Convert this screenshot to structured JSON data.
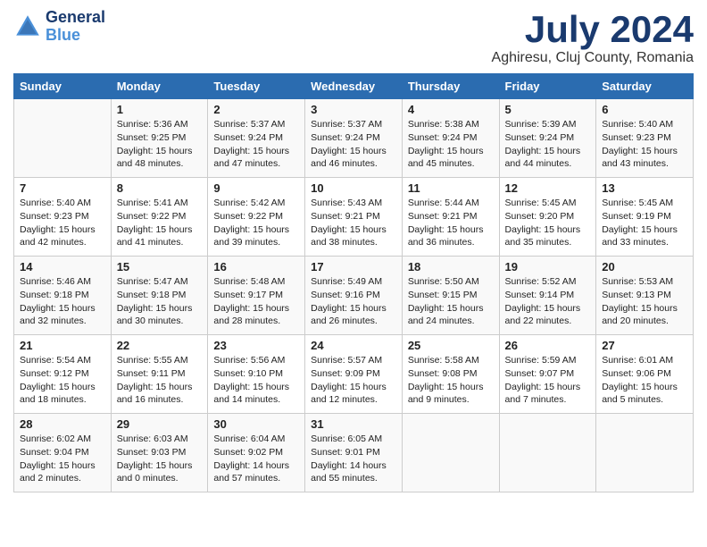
{
  "logo": {
    "line1": "General",
    "line2": "Blue"
  },
  "title": "July 2024",
  "subtitle": "Aghiresu, Cluj County, Romania",
  "columns": [
    "Sunday",
    "Monday",
    "Tuesday",
    "Wednesday",
    "Thursday",
    "Friday",
    "Saturday"
  ],
  "weeks": [
    [
      {
        "day": "",
        "info": ""
      },
      {
        "day": "1",
        "info": "Sunrise: 5:36 AM\nSunset: 9:25 PM\nDaylight: 15 hours\nand 48 minutes."
      },
      {
        "day": "2",
        "info": "Sunrise: 5:37 AM\nSunset: 9:24 PM\nDaylight: 15 hours\nand 47 minutes."
      },
      {
        "day": "3",
        "info": "Sunrise: 5:37 AM\nSunset: 9:24 PM\nDaylight: 15 hours\nand 46 minutes."
      },
      {
        "day": "4",
        "info": "Sunrise: 5:38 AM\nSunset: 9:24 PM\nDaylight: 15 hours\nand 45 minutes."
      },
      {
        "day": "5",
        "info": "Sunrise: 5:39 AM\nSunset: 9:24 PM\nDaylight: 15 hours\nand 44 minutes."
      },
      {
        "day": "6",
        "info": "Sunrise: 5:40 AM\nSunset: 9:23 PM\nDaylight: 15 hours\nand 43 minutes."
      }
    ],
    [
      {
        "day": "7",
        "info": "Sunrise: 5:40 AM\nSunset: 9:23 PM\nDaylight: 15 hours\nand 42 minutes."
      },
      {
        "day": "8",
        "info": "Sunrise: 5:41 AM\nSunset: 9:22 PM\nDaylight: 15 hours\nand 41 minutes."
      },
      {
        "day": "9",
        "info": "Sunrise: 5:42 AM\nSunset: 9:22 PM\nDaylight: 15 hours\nand 39 minutes."
      },
      {
        "day": "10",
        "info": "Sunrise: 5:43 AM\nSunset: 9:21 PM\nDaylight: 15 hours\nand 38 minutes."
      },
      {
        "day": "11",
        "info": "Sunrise: 5:44 AM\nSunset: 9:21 PM\nDaylight: 15 hours\nand 36 minutes."
      },
      {
        "day": "12",
        "info": "Sunrise: 5:45 AM\nSunset: 9:20 PM\nDaylight: 15 hours\nand 35 minutes."
      },
      {
        "day": "13",
        "info": "Sunrise: 5:45 AM\nSunset: 9:19 PM\nDaylight: 15 hours\nand 33 minutes."
      }
    ],
    [
      {
        "day": "14",
        "info": "Sunrise: 5:46 AM\nSunset: 9:18 PM\nDaylight: 15 hours\nand 32 minutes."
      },
      {
        "day": "15",
        "info": "Sunrise: 5:47 AM\nSunset: 9:18 PM\nDaylight: 15 hours\nand 30 minutes."
      },
      {
        "day": "16",
        "info": "Sunrise: 5:48 AM\nSunset: 9:17 PM\nDaylight: 15 hours\nand 28 minutes."
      },
      {
        "day": "17",
        "info": "Sunrise: 5:49 AM\nSunset: 9:16 PM\nDaylight: 15 hours\nand 26 minutes."
      },
      {
        "day": "18",
        "info": "Sunrise: 5:50 AM\nSunset: 9:15 PM\nDaylight: 15 hours\nand 24 minutes."
      },
      {
        "day": "19",
        "info": "Sunrise: 5:52 AM\nSunset: 9:14 PM\nDaylight: 15 hours\nand 22 minutes."
      },
      {
        "day": "20",
        "info": "Sunrise: 5:53 AM\nSunset: 9:13 PM\nDaylight: 15 hours\nand 20 minutes."
      }
    ],
    [
      {
        "day": "21",
        "info": "Sunrise: 5:54 AM\nSunset: 9:12 PM\nDaylight: 15 hours\nand 18 minutes."
      },
      {
        "day": "22",
        "info": "Sunrise: 5:55 AM\nSunset: 9:11 PM\nDaylight: 15 hours\nand 16 minutes."
      },
      {
        "day": "23",
        "info": "Sunrise: 5:56 AM\nSunset: 9:10 PM\nDaylight: 15 hours\nand 14 minutes."
      },
      {
        "day": "24",
        "info": "Sunrise: 5:57 AM\nSunset: 9:09 PM\nDaylight: 15 hours\nand 12 minutes."
      },
      {
        "day": "25",
        "info": "Sunrise: 5:58 AM\nSunset: 9:08 PM\nDaylight: 15 hours\nand 9 minutes."
      },
      {
        "day": "26",
        "info": "Sunrise: 5:59 AM\nSunset: 9:07 PM\nDaylight: 15 hours\nand 7 minutes."
      },
      {
        "day": "27",
        "info": "Sunrise: 6:01 AM\nSunset: 9:06 PM\nDaylight: 15 hours\nand 5 minutes."
      }
    ],
    [
      {
        "day": "28",
        "info": "Sunrise: 6:02 AM\nSunset: 9:04 PM\nDaylight: 15 hours\nand 2 minutes."
      },
      {
        "day": "29",
        "info": "Sunrise: 6:03 AM\nSunset: 9:03 PM\nDaylight: 15 hours\nand 0 minutes."
      },
      {
        "day": "30",
        "info": "Sunrise: 6:04 AM\nSunset: 9:02 PM\nDaylight: 14 hours\nand 57 minutes."
      },
      {
        "day": "31",
        "info": "Sunrise: 6:05 AM\nSunset: 9:01 PM\nDaylight: 14 hours\nand 55 minutes."
      },
      {
        "day": "",
        "info": ""
      },
      {
        "day": "",
        "info": ""
      },
      {
        "day": "",
        "info": ""
      }
    ]
  ]
}
